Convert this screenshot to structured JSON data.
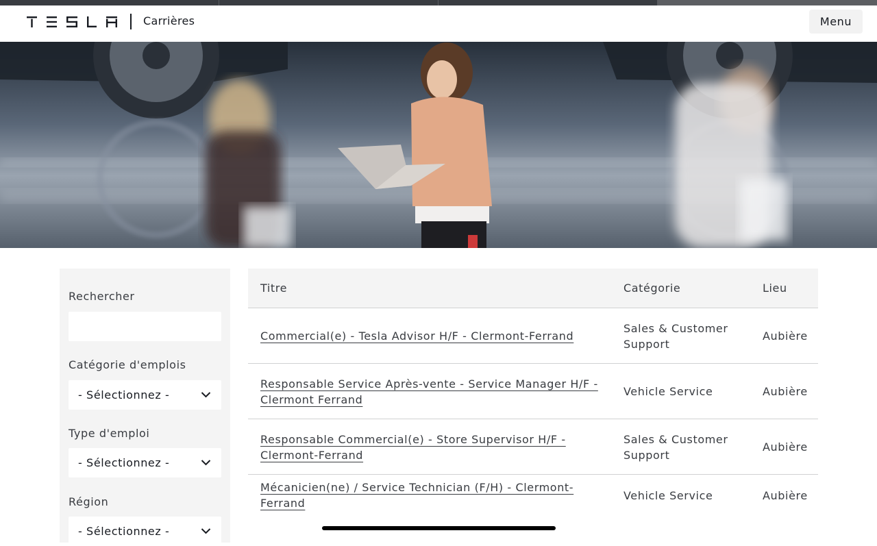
{
  "header": {
    "logo_text": "TESLA",
    "section_title": "Carrières",
    "menu_label": "Menu"
  },
  "filters": {
    "search": {
      "label": "Rechercher",
      "value": "",
      "placeholder": ""
    },
    "category": {
      "label": "Catégorie d'emplois",
      "selected": "- Sélectionnez -"
    },
    "job_type": {
      "label": "Type d'emploi",
      "selected": "- Sélectionnez -"
    },
    "region": {
      "label": "Région",
      "selected": "- Sélectionnez -"
    }
  },
  "jobs_table": {
    "columns": [
      "Titre",
      "Catégorie",
      "Lieu"
    ],
    "rows": [
      {
        "title": "Commercial(e) - Tesla Advisor H/F - Clermont-Ferrand",
        "category": "Sales & Customer Support",
        "location": "Aubière"
      },
      {
        "title": "Responsable Service Après-vente - Service Manager H/F - Clermont Ferrand",
        "category": "Vehicle Service",
        "location": "Aubière"
      },
      {
        "title": "Responsable Commercial(e) - Store Supervisor H/F - Clermont-Ferrand",
        "category": "Sales & Customer Support",
        "location": "Aubière"
      },
      {
        "title": "Mécanicien(ne) / Service Technician (F/H) - Clermont-Ferrand",
        "category": "Vehicle Service",
        "location": "Aubière"
      }
    ]
  },
  "colors": {
    "text": "#393c41",
    "dark": "#171a20",
    "panel": "#f4f4f4",
    "divider": "#d0d1d2"
  },
  "icons": {
    "dropdown": "chevron-down-icon"
  }
}
